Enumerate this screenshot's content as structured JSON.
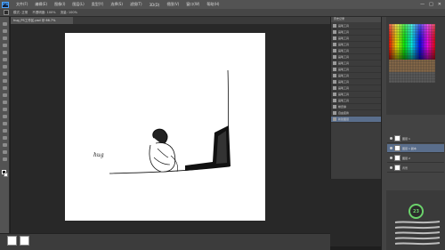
{
  "app": {
    "logo_text": "Ps",
    "menu": [
      "文件(F)",
      "编辑(E)",
      "图像(I)",
      "图层(L)",
      "类型(Y)",
      "选择(S)",
      "滤镜(T)",
      "3D(D)",
      "视图(V)",
      "窗口(W)",
      "帮助(H)"
    ],
    "window_controls": [
      "—",
      "□",
      "✕"
    ]
  },
  "options_bar": {
    "items": [
      "模式: 正常",
      "不透明度: 100%",
      "流量: 100%"
    ]
  },
  "document": {
    "tab_label": "hug_PS工作区.psd @ 66.7%",
    "caption": "hug"
  },
  "history": {
    "header": "历史记录",
    "items": [
      "画笔工具",
      "画笔工具",
      "画笔工具",
      "画笔工具",
      "画笔工具",
      "画笔工具",
      "画笔工具",
      "画笔工具",
      "画笔工具",
      "画笔工具",
      "画笔工具",
      "画笔工具",
      "画笔工具",
      "橡皮擦",
      "自由变换",
      "新建图层"
    ],
    "active_index": 15
  },
  "layers": {
    "rows": [
      "图层 1",
      "图层 1 副本",
      "图层 2",
      "背景"
    ],
    "active_index": 1
  },
  "brushes": {
    "size_badge": "23"
  },
  "preview_dock": {
    "items": [
      "",
      ""
    ]
  }
}
